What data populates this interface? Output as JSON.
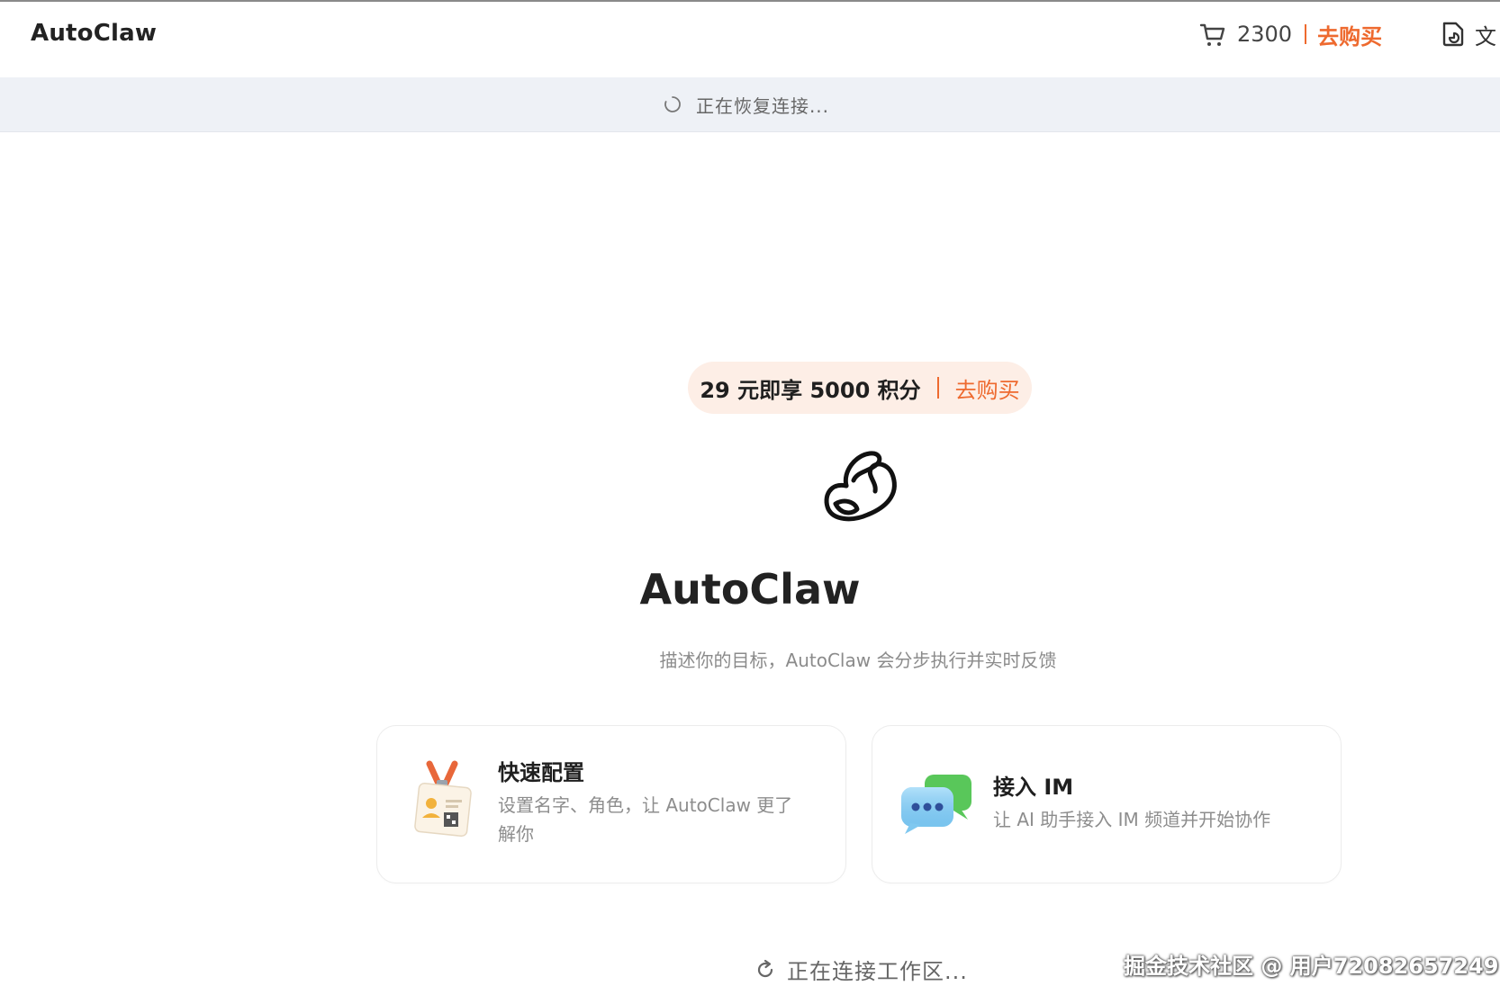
{
  "header": {
    "app_title": "AutoClaw",
    "credits": {
      "value": "2300",
      "buy_label": "去购买",
      "icon": "cart-icon"
    },
    "doc_button": {
      "label": "文",
      "icon": "document-icon"
    }
  },
  "banner": {
    "text": "正在恢复连接...",
    "icon": "spinner-icon"
  },
  "promo": {
    "text": "29 元即享 5000 积分",
    "link": "去购买"
  },
  "hero": {
    "logo": "autoclaw-logo-icon",
    "title": "AutoClaw",
    "subtitle": "描述你的目标，AutoClaw 会分步执行并实时反馈"
  },
  "cards": [
    {
      "title": "快速配置",
      "desc_line1": "设置名字、角色，让 AutoClaw 更了",
      "desc_line2": "解你",
      "icon": "id-badge-icon"
    },
    {
      "title": "接入 IM",
      "desc": "让 AI 助手接入 IM 频道并开始协作",
      "icon": "chat-bubbles-icon"
    }
  ],
  "footer": {
    "status": "正在连接工作区...",
    "icon": "refresh-icon"
  },
  "watermark": "掘金技术社区 @ 用户72082657249",
  "colors": {
    "accent": "#ee6a2f",
    "banner_bg": "#eef1f6",
    "promo_bg": "#fdeee6"
  }
}
